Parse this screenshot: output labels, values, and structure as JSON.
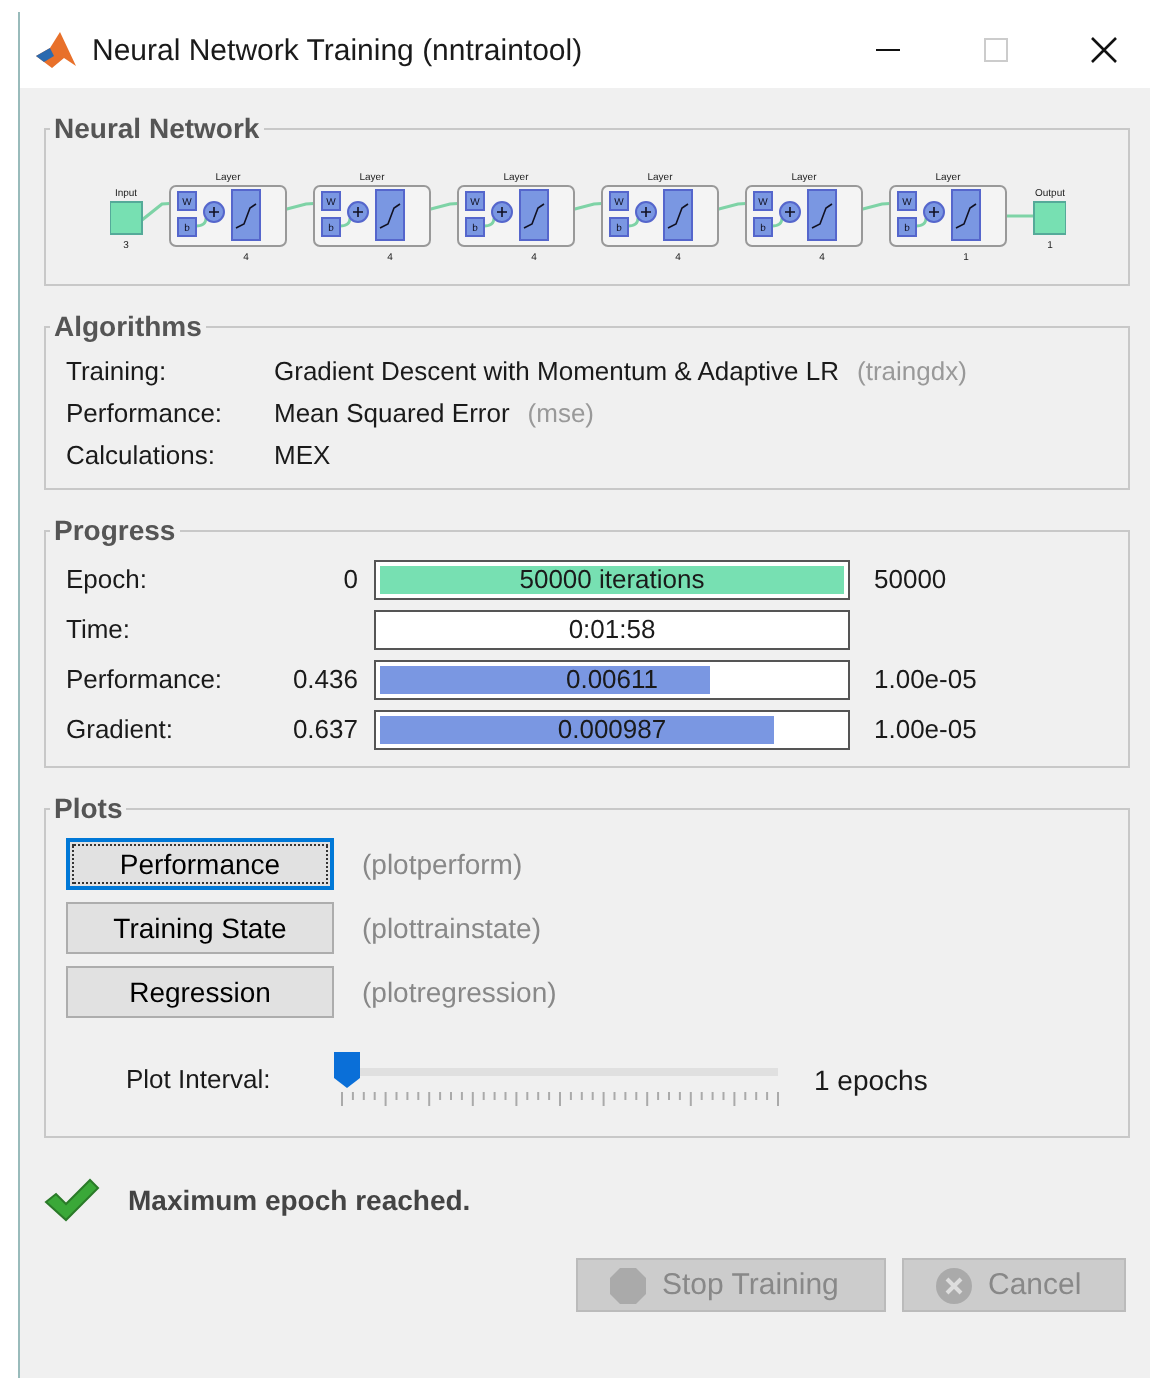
{
  "window": {
    "title": "Neural Network Training (nntraintool)"
  },
  "neural_network": {
    "title": "Neural Network",
    "input": {
      "label": "Input",
      "size": "3"
    },
    "layers": [
      {
        "label": "Layer",
        "weight": "W",
        "bias": "b",
        "size": "4"
      },
      {
        "label": "Layer",
        "weight": "W",
        "bias": "b",
        "size": "4"
      },
      {
        "label": "Layer",
        "weight": "W",
        "bias": "b",
        "size": "4"
      },
      {
        "label": "Layer",
        "weight": "W",
        "bias": "b",
        "size": "4"
      },
      {
        "label": "Layer",
        "weight": "W",
        "bias": "b",
        "size": "4"
      },
      {
        "label": "Layer",
        "weight": "W",
        "bias": "b",
        "size": "1"
      }
    ],
    "output": {
      "label": "Output",
      "size": "1"
    }
  },
  "algorithms": {
    "title": "Algorithms",
    "rows": [
      {
        "label": "Training:",
        "value": "Gradient Descent with Momentum & Adaptive LR",
        "code": "(traingdx)"
      },
      {
        "label": "Performance:",
        "value": "Mean Squared Error",
        "code": "(mse)"
      },
      {
        "label": "Calculations:",
        "value": "MEX"
      }
    ]
  },
  "progress": {
    "title": "Progress",
    "rows": [
      {
        "label": "Epoch:",
        "start": "0",
        "bar_text": "50000 iterations",
        "kind": "epoch",
        "level": 1,
        "end": "50000"
      },
      {
        "label": "Time:",
        "bar_text": "0:01:58",
        "kind": "time"
      },
      {
        "label": "Performance:",
        "start": "0.436",
        "bar_text": "0.00611",
        "kind": "measure",
        "level": 0.71,
        "end": "1.00e-05"
      },
      {
        "label": "Gradient:",
        "start": "0.637",
        "bar_text": "0.000987",
        "kind": "measure",
        "level": 0.85,
        "end": "1.00e-05"
      }
    ]
  },
  "plots": {
    "title": "Plots",
    "buttons": [
      {
        "label": "Performance",
        "function": "(plotperform)",
        "focused": true
      },
      {
        "label": "Training State",
        "function": "(plottrainstate)",
        "focused": false
      },
      {
        "label": "Regression",
        "function": "(plotregression)",
        "focused": false
      }
    ],
    "interval": {
      "label": "Plot Interval:",
      "level": 0,
      "value": "1 epochs"
    }
  },
  "status": {
    "text": "Maximum epoch reached."
  },
  "buttons": [
    {
      "label": "Stop Training",
      "kind": "stop",
      "disabled": true
    },
    {
      "label": "Cancel",
      "kind": "cancel",
      "disabled": true
    }
  ]
}
